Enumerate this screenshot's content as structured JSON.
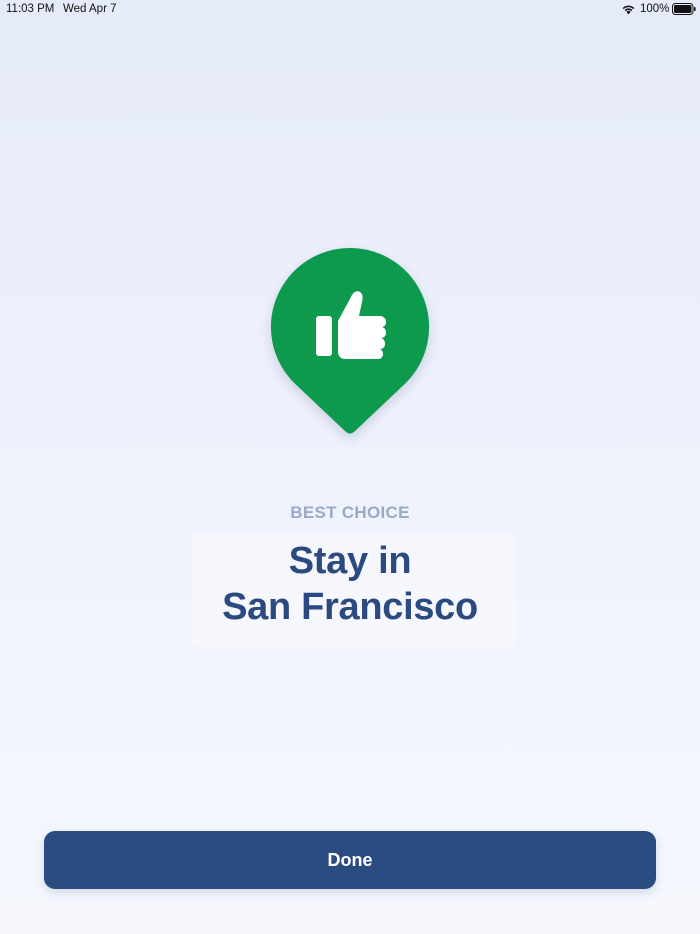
{
  "status_bar": {
    "time": "11:03 PM",
    "date": "Wed Apr 7",
    "battery_percent": "100%",
    "icons": [
      "wifi-icon",
      "battery-icon"
    ]
  },
  "pin": {
    "icon": "thumbs-up-icon",
    "color": "#0e9a4e"
  },
  "result": {
    "eyebrow": "BEST CHOICE",
    "headline_line1": "Stay in",
    "headline_line2": "San Francisco"
  },
  "actions": {
    "done_label": "Done"
  },
  "colors": {
    "primary": "#2a4c81",
    "accent_green": "#0e9a4e",
    "eyebrow": "#9aa9c6"
  }
}
